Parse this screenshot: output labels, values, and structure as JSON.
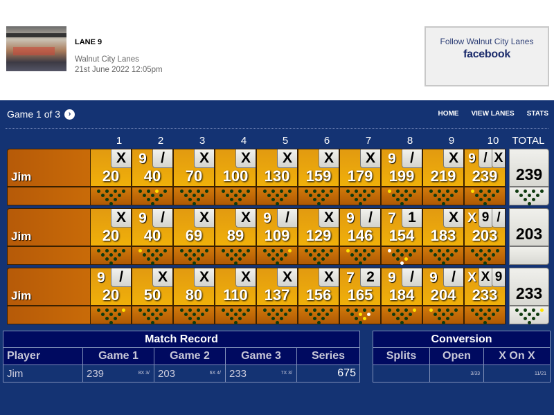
{
  "header": {
    "lane_title": "LANE 9",
    "venue": "Walnut City Lanes",
    "datetime": "21st June 2022 12:05pm",
    "follow_text": "Follow Walnut City Lanes",
    "social_network": "facebook"
  },
  "nav": {
    "game_label": "Game 1 of 3",
    "next_icon": "chevron-right-circle-icon",
    "menu": [
      "HOME",
      "VIEW LANES",
      "STATS"
    ]
  },
  "scoreboard": {
    "frame_headers": [
      "1",
      "2",
      "3",
      "4",
      "5",
      "6",
      "7",
      "8",
      "9",
      "10",
      "TOTAL"
    ],
    "games": [
      {
        "player": "Jim",
        "total": "239",
        "frames": [
          {
            "balls": [
              "",
              "X"
            ],
            "score": "20",
            "pins_left": [],
            "mark": [
              "",
              ""
            ]
          },
          {
            "balls": [
              "9",
              "/"
            ],
            "score": "40",
            "pins_left": [
              {
                "pin": 9,
                "color": "yellow"
              }
            ]
          },
          {
            "balls": [
              "",
              "X"
            ],
            "score": "70",
            "pins_left": []
          },
          {
            "balls": [
              "",
              "X"
            ],
            "score": "100",
            "pins_left": []
          },
          {
            "balls": [
              "",
              "X"
            ],
            "score": "130",
            "pins_left": []
          },
          {
            "balls": [
              "",
              "X"
            ],
            "score": "159",
            "pins_left": []
          },
          {
            "balls": [
              "",
              "X"
            ],
            "score": "179",
            "pins_left": []
          },
          {
            "balls": [
              "9",
              "/"
            ],
            "score": "199",
            "pins_left": [
              {
                "pin": 7,
                "color": "yellow"
              }
            ]
          },
          {
            "balls": [
              "",
              "X"
            ],
            "score": "219",
            "pins_left": []
          },
          {
            "balls": [
              "9",
              "/",
              "X"
            ],
            "score": "239",
            "pins_left": [
              {
                "pin": 7,
                "color": "yellow"
              }
            ]
          }
        ],
        "total_pins_left": []
      },
      {
        "player": "Jim",
        "total": "203",
        "frames": [
          {
            "balls": [
              "",
              "X"
            ],
            "score": "20",
            "pins_left": []
          },
          {
            "balls": [
              "9",
              "/"
            ],
            "score": "40",
            "pins_left": [
              {
                "pin": 7,
                "color": "yellow"
              }
            ]
          },
          {
            "balls": [
              "",
              "X"
            ],
            "score": "69",
            "pins_left": []
          },
          {
            "balls": [
              "",
              "X"
            ],
            "score": "89",
            "pins_left": []
          },
          {
            "balls": [
              "9",
              "/"
            ],
            "score": "109",
            "pins_left": [
              {
                "pin": 10,
                "color": "yellow"
              }
            ]
          },
          {
            "balls": [
              "",
              "X"
            ],
            "score": "129",
            "pins_left": []
          },
          {
            "balls": [
              "9",
              "/"
            ],
            "score": "146",
            "pins_left": [
              {
                "pin": 7,
                "color": "yellow"
              }
            ]
          },
          {
            "balls": [
              "7",
              "1"
            ],
            "score": "154",
            "pins_left": [
              {
                "pin": 7,
                "color": "white"
              },
              {
                "pin": 1,
                "color": "white"
              },
              {
                "pin": 3,
                "color": "yellow"
              }
            ]
          },
          {
            "balls": [
              "",
              "X"
            ],
            "score": "183",
            "pins_left": []
          },
          {
            "balls": [
              "X",
              "9",
              "/"
            ],
            "score": "203",
            "pins_left": []
          }
        ],
        "total_pins_left": null
      },
      {
        "player": "Jim",
        "total": "233",
        "frames": [
          {
            "balls": [
              "9",
              "/"
            ],
            "score": "20",
            "pins_left": [
              {
                "pin": 10,
                "color": "yellow"
              }
            ]
          },
          {
            "balls": [
              "",
              "X"
            ],
            "score": "50",
            "pins_left": []
          },
          {
            "balls": [
              "",
              "X"
            ],
            "score": "80",
            "pins_left": []
          },
          {
            "balls": [
              "",
              "X"
            ],
            "score": "110",
            "pins_left": []
          },
          {
            "balls": [
              "",
              "X"
            ],
            "score": "137",
            "pins_left": []
          },
          {
            "balls": [
              "",
              "X"
            ],
            "score": "156",
            "pins_left": []
          },
          {
            "balls": [
              "7",
              "2"
            ],
            "score": "165",
            "pins_left": [
              {
                "pin": 5,
                "color": "yellow"
              },
              {
                "pin": 6,
                "color": "white"
              },
              {
                "pin": 3,
                "color": "yellow"
              }
            ]
          },
          {
            "balls": [
              "9",
              "/"
            ],
            "score": "184",
            "pins_left": [
              {
                "pin": 10,
                "color": "yellow"
              }
            ]
          },
          {
            "balls": [
              "9",
              "/"
            ],
            "score": "204",
            "pins_left": [
              {
                "pin": 7,
                "color": "yellow"
              }
            ]
          },
          {
            "balls": [
              "X",
              "X",
              "9"
            ],
            "score": "233",
            "pins_left": []
          }
        ],
        "total_pins_left": [
          {
            "pin": 10,
            "color": "yellow"
          }
        ]
      }
    ]
  },
  "match_record": {
    "title": "Match Record",
    "columns": [
      "Player",
      "Game 1",
      "Game 2",
      "Game 3",
      "Series"
    ],
    "rows": [
      {
        "player": "Jim",
        "games": [
          {
            "score": "239",
            "detail": "8X 3/"
          },
          {
            "score": "203",
            "detail": "6X 4/"
          },
          {
            "score": "233",
            "detail": "7X 3/"
          }
        ],
        "series": "675"
      }
    ]
  },
  "conversion": {
    "title": "Conversion",
    "columns": [
      "Splits",
      "Open",
      "X On X"
    ],
    "rows": [
      [
        "",
        "3/33",
        "11/21"
      ]
    ]
  }
}
